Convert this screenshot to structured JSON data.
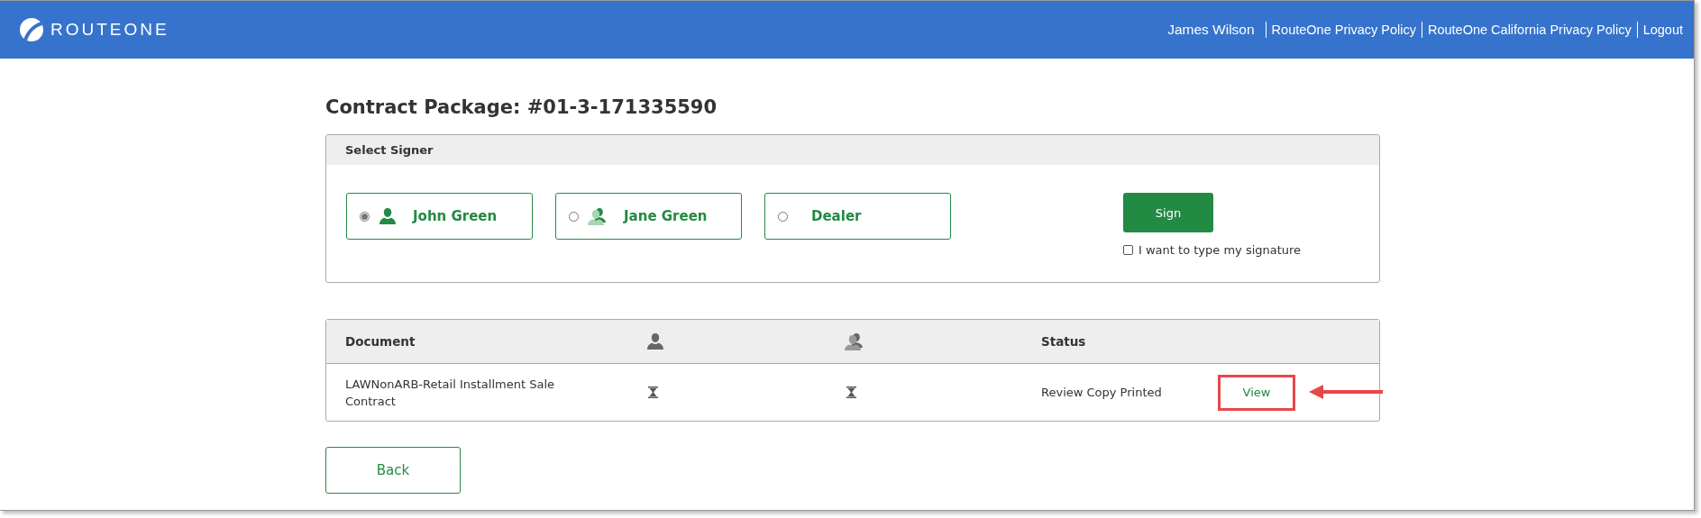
{
  "header": {
    "logo": "ROUTEONE",
    "user": "James Wilson",
    "links": [
      {
        "label": "RouteOne Privacy Policy"
      },
      {
        "label": "RouteOne California Privacy Policy"
      },
      {
        "label": "Logout"
      }
    ]
  },
  "title": "Contract Package: #01-3-171335590",
  "signer_panel": {
    "heading": "Select Signer",
    "signers": [
      {
        "name": "John Green",
        "kind": "primary",
        "selected": true
      },
      {
        "name": "Jane Green",
        "kind": "secondary",
        "selected": false
      },
      {
        "name": "Dealer",
        "kind": "dealer",
        "selected": false
      }
    ],
    "sign_button": "Sign",
    "type_signature": {
      "label": "I want to type my signature",
      "checked": false
    }
  },
  "documents": {
    "columns": [
      {
        "label": "Document",
        "kind": "text"
      },
      {
        "kind": "primary"
      },
      {
        "kind": "secondary"
      },
      {
        "label": "Status",
        "kind": "text"
      },
      {
        "kind": "blank"
      }
    ],
    "rows": [
      {
        "document": "LAWNonARB-Retail Installment Sale Contract",
        "status": "Review Copy Printed",
        "action": "View",
        "highlighted": true
      }
    ]
  },
  "back_button": "Back"
}
